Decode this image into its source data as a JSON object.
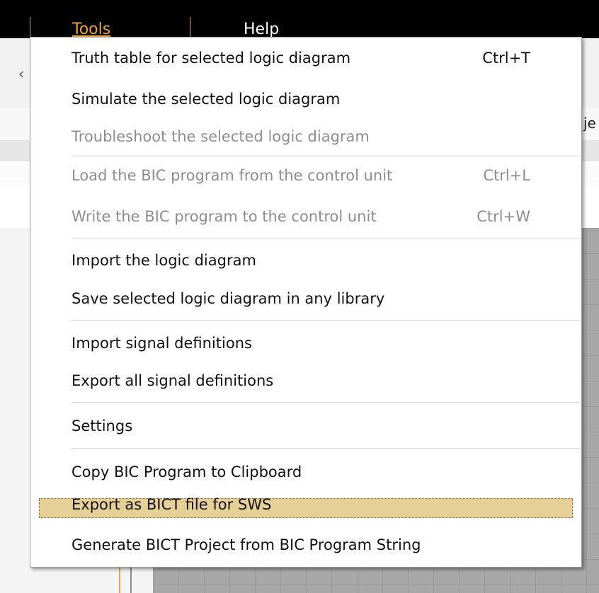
{
  "menubar": {
    "items": [
      {
        "label": "Tools",
        "active": true
      },
      {
        "label": "Help",
        "active": false
      }
    ]
  },
  "background": {
    "edge_text": "je",
    "chevron": "‹"
  },
  "menu": {
    "items": [
      {
        "label": "Truth table for selected logic diagram",
        "shortcut": "Ctrl+T",
        "enabled": true
      },
      {
        "label": "Simulate the selected logic diagram",
        "shortcut": "",
        "enabled": true
      },
      {
        "label": "Troubleshoot the selected logic diagram",
        "shortcut": "",
        "enabled": false
      },
      {
        "label": "Load the BIC program from the control unit",
        "shortcut": "Ctrl+L",
        "enabled": false
      },
      {
        "label": "Write the BIC program to the control unit",
        "shortcut": "Ctrl+W",
        "enabled": false
      },
      {
        "label": "Import the logic diagram",
        "shortcut": "",
        "enabled": true
      },
      {
        "label": "Save selected logic diagram in any library",
        "shortcut": "",
        "enabled": true
      },
      {
        "label": "Import signal definitions",
        "shortcut": "",
        "enabled": true
      },
      {
        "label": "Export all signal definitions",
        "shortcut": "",
        "enabled": true
      },
      {
        "label": "Settings",
        "shortcut": "",
        "enabled": true
      },
      {
        "label": "Copy BIC Program to Clipboard",
        "shortcut": "",
        "enabled": true
      },
      {
        "label": "Export as BICT file for SWS",
        "shortcut": "",
        "enabled": true,
        "highlighted": true
      },
      {
        "label": "Generate BICT Project from BIC Program String",
        "shortcut": "",
        "enabled": true
      }
    ]
  },
  "colors": {
    "accent": "#e8a33c",
    "highlight": "#e7cf98",
    "disabled_text": "#8d8d8d"
  }
}
